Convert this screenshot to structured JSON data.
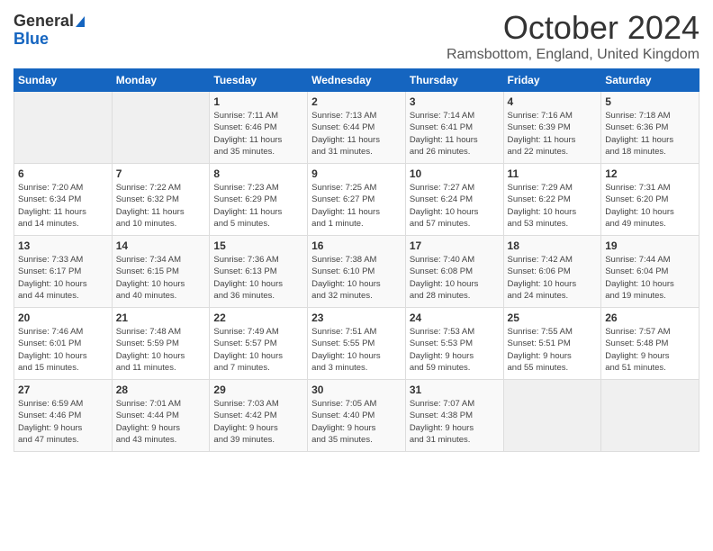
{
  "header": {
    "logo_line1": "General",
    "logo_line2": "Blue",
    "month_title": "October 2024",
    "location": "Ramsbottom, England, United Kingdom"
  },
  "days_of_week": [
    "Sunday",
    "Monday",
    "Tuesday",
    "Wednesday",
    "Thursday",
    "Friday",
    "Saturday"
  ],
  "weeks": [
    [
      {
        "num": "",
        "detail": ""
      },
      {
        "num": "",
        "detail": ""
      },
      {
        "num": "1",
        "detail": "Sunrise: 7:11 AM\nSunset: 6:46 PM\nDaylight: 11 hours\nand 35 minutes."
      },
      {
        "num": "2",
        "detail": "Sunrise: 7:13 AM\nSunset: 6:44 PM\nDaylight: 11 hours\nand 31 minutes."
      },
      {
        "num": "3",
        "detail": "Sunrise: 7:14 AM\nSunset: 6:41 PM\nDaylight: 11 hours\nand 26 minutes."
      },
      {
        "num": "4",
        "detail": "Sunrise: 7:16 AM\nSunset: 6:39 PM\nDaylight: 11 hours\nand 22 minutes."
      },
      {
        "num": "5",
        "detail": "Sunrise: 7:18 AM\nSunset: 6:36 PM\nDaylight: 11 hours\nand 18 minutes."
      }
    ],
    [
      {
        "num": "6",
        "detail": "Sunrise: 7:20 AM\nSunset: 6:34 PM\nDaylight: 11 hours\nand 14 minutes."
      },
      {
        "num": "7",
        "detail": "Sunrise: 7:22 AM\nSunset: 6:32 PM\nDaylight: 11 hours\nand 10 minutes."
      },
      {
        "num": "8",
        "detail": "Sunrise: 7:23 AM\nSunset: 6:29 PM\nDaylight: 11 hours\nand 5 minutes."
      },
      {
        "num": "9",
        "detail": "Sunrise: 7:25 AM\nSunset: 6:27 PM\nDaylight: 11 hours\nand 1 minute."
      },
      {
        "num": "10",
        "detail": "Sunrise: 7:27 AM\nSunset: 6:24 PM\nDaylight: 10 hours\nand 57 minutes."
      },
      {
        "num": "11",
        "detail": "Sunrise: 7:29 AM\nSunset: 6:22 PM\nDaylight: 10 hours\nand 53 minutes."
      },
      {
        "num": "12",
        "detail": "Sunrise: 7:31 AM\nSunset: 6:20 PM\nDaylight: 10 hours\nand 49 minutes."
      }
    ],
    [
      {
        "num": "13",
        "detail": "Sunrise: 7:33 AM\nSunset: 6:17 PM\nDaylight: 10 hours\nand 44 minutes."
      },
      {
        "num": "14",
        "detail": "Sunrise: 7:34 AM\nSunset: 6:15 PM\nDaylight: 10 hours\nand 40 minutes."
      },
      {
        "num": "15",
        "detail": "Sunrise: 7:36 AM\nSunset: 6:13 PM\nDaylight: 10 hours\nand 36 minutes."
      },
      {
        "num": "16",
        "detail": "Sunrise: 7:38 AM\nSunset: 6:10 PM\nDaylight: 10 hours\nand 32 minutes."
      },
      {
        "num": "17",
        "detail": "Sunrise: 7:40 AM\nSunset: 6:08 PM\nDaylight: 10 hours\nand 28 minutes."
      },
      {
        "num": "18",
        "detail": "Sunrise: 7:42 AM\nSunset: 6:06 PM\nDaylight: 10 hours\nand 24 minutes."
      },
      {
        "num": "19",
        "detail": "Sunrise: 7:44 AM\nSunset: 6:04 PM\nDaylight: 10 hours\nand 19 minutes."
      }
    ],
    [
      {
        "num": "20",
        "detail": "Sunrise: 7:46 AM\nSunset: 6:01 PM\nDaylight: 10 hours\nand 15 minutes."
      },
      {
        "num": "21",
        "detail": "Sunrise: 7:48 AM\nSunset: 5:59 PM\nDaylight: 10 hours\nand 11 minutes."
      },
      {
        "num": "22",
        "detail": "Sunrise: 7:49 AM\nSunset: 5:57 PM\nDaylight: 10 hours\nand 7 minutes."
      },
      {
        "num": "23",
        "detail": "Sunrise: 7:51 AM\nSunset: 5:55 PM\nDaylight: 10 hours\nand 3 minutes."
      },
      {
        "num": "24",
        "detail": "Sunrise: 7:53 AM\nSunset: 5:53 PM\nDaylight: 9 hours\nand 59 minutes."
      },
      {
        "num": "25",
        "detail": "Sunrise: 7:55 AM\nSunset: 5:51 PM\nDaylight: 9 hours\nand 55 minutes."
      },
      {
        "num": "26",
        "detail": "Sunrise: 7:57 AM\nSunset: 5:48 PM\nDaylight: 9 hours\nand 51 minutes."
      }
    ],
    [
      {
        "num": "27",
        "detail": "Sunrise: 6:59 AM\nSunset: 4:46 PM\nDaylight: 9 hours\nand 47 minutes."
      },
      {
        "num": "28",
        "detail": "Sunrise: 7:01 AM\nSunset: 4:44 PM\nDaylight: 9 hours\nand 43 minutes."
      },
      {
        "num": "29",
        "detail": "Sunrise: 7:03 AM\nSunset: 4:42 PM\nDaylight: 9 hours\nand 39 minutes."
      },
      {
        "num": "30",
        "detail": "Sunrise: 7:05 AM\nSunset: 4:40 PM\nDaylight: 9 hours\nand 35 minutes."
      },
      {
        "num": "31",
        "detail": "Sunrise: 7:07 AM\nSunset: 4:38 PM\nDaylight: 9 hours\nand 31 minutes."
      },
      {
        "num": "",
        "detail": ""
      },
      {
        "num": "",
        "detail": ""
      }
    ]
  ]
}
